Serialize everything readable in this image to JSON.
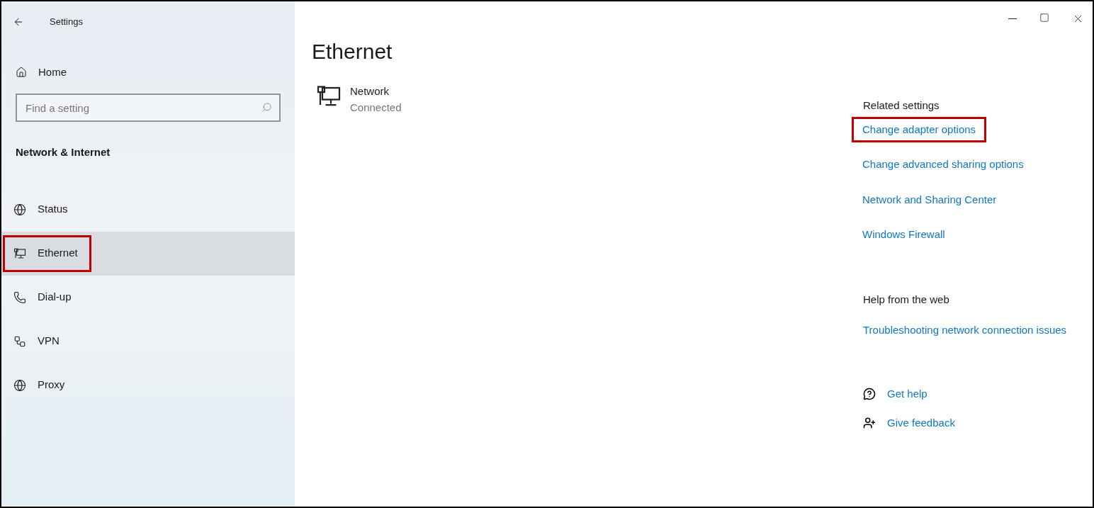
{
  "window": {
    "title": "Settings"
  },
  "sidebar": {
    "home": "Home",
    "search": {
      "placeholder": "Find a setting"
    },
    "section": "Network & Internet",
    "items": [
      {
        "label": "Status",
        "selected": false,
        "highlighted": false
      },
      {
        "label": "Ethernet",
        "selected": true,
        "highlighted": true
      },
      {
        "label": "Dial-up",
        "selected": false,
        "highlighted": false
      },
      {
        "label": "VPN",
        "selected": false,
        "highlighted": false
      },
      {
        "label": "Proxy",
        "selected": false,
        "highlighted": false
      }
    ]
  },
  "main": {
    "title": "Ethernet",
    "connection": {
      "name": "Network",
      "status": "Connected"
    }
  },
  "related": {
    "heading": "Related settings",
    "links": [
      {
        "label": "Change adapter options",
        "highlighted": true
      },
      {
        "label": "Change advanced sharing options",
        "highlighted": false
      },
      {
        "label": "Network and Sharing Center",
        "highlighted": false
      },
      {
        "label": "Windows Firewall",
        "highlighted": false
      }
    ]
  },
  "help": {
    "heading": "Help from the web",
    "links": [
      {
        "label": "Troubleshooting network connection issues"
      }
    ]
  },
  "support": [
    {
      "label": "Get help",
      "kind": "help"
    },
    {
      "label": "Give feedback",
      "kind": "feedback"
    }
  ]
}
